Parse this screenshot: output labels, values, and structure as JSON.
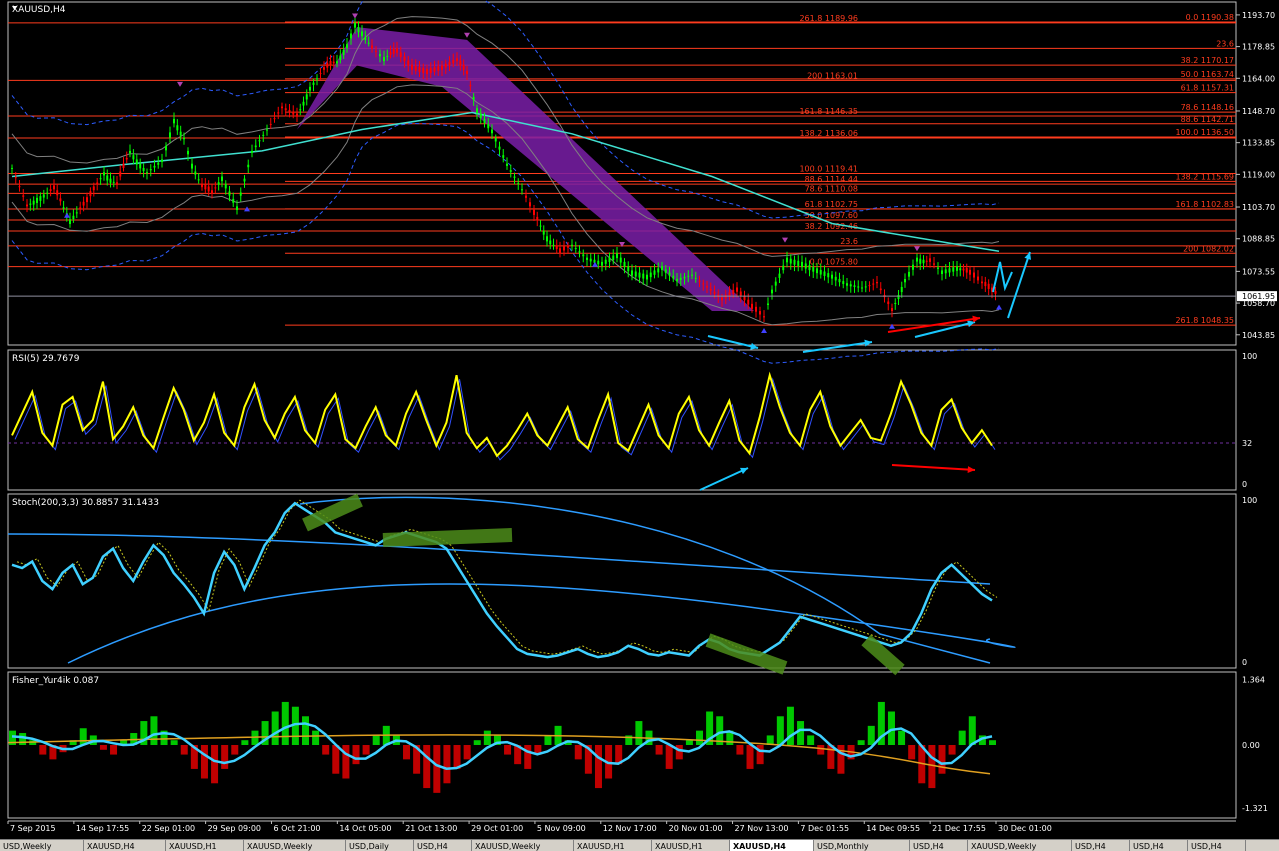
{
  "chart_data": [
    {
      "type": "candlestick",
      "title": "XAUUSD,H4",
      "y_ticks": [
        "1193.70",
        "1178.85",
        "1164.00",
        "1148.70",
        "1133.85",
        "1119.00",
        "1103.70",
        "1088.85",
        "1073.55",
        "1058.70",
        "1043.85"
      ],
      "ylim": [
        1040,
        1196
      ],
      "current_price": "1061.95",
      "fib_left": [
        {
          "label": "261.8 1189.96",
          "value": 1189.96
        },
        {
          "label": "200 1163.01",
          "value": 1163.01
        },
        {
          "label": "161.8 1146.35",
          "value": 1146.35
        },
        {
          "label": "138.2 1136.06",
          "value": 1136.06
        },
        {
          "label": "100.0 1119.41",
          "value": 1119.41
        },
        {
          "label": "88.6 1114.44",
          "value": 1114.44
        },
        {
          "label": "78.6 1110.08",
          "value": 1110.08
        },
        {
          "label": "61.8 1102.75",
          "value": 1102.75
        },
        {
          "label": "50.0 1097.60",
          "value": 1097.6
        },
        {
          "label": "38.2 1092.46",
          "value": 1092.46
        },
        {
          "label": "23.6",
          "value": 1085.5
        },
        {
          "label": "0.0 1075.80",
          "value": 1075.8
        }
      ],
      "fib_right": [
        {
          "label": "0.0 1190.38",
          "value": 1190.38
        },
        {
          "label": "23.6",
          "value": 1178.0
        },
        {
          "label": "38.2 1170.17",
          "value": 1170.17
        },
        {
          "label": "50.0 1163.74",
          "value": 1163.74
        },
        {
          "label": "61.8 1157.31",
          "value": 1157.31
        },
        {
          "label": "78.6 1148.16",
          "value": 1148.16
        },
        {
          "label": "88.6 1142.71",
          "value": 1142.71
        },
        {
          "label": "100.0 1136.50",
          "value": 1136.5
        },
        {
          "label": "138.2 1115.69",
          "value": 1115.69
        },
        {
          "label": "161.8 1102.83",
          "value": 1102.83
        },
        {
          "label": "200 1082.02",
          "value": 1082.02
        },
        {
          "label": "261.8 1048.35",
          "value": 1048.35
        }
      ],
      "close_path": [
        [
          0,
          1122
        ],
        [
          15,
          1104
        ],
        [
          25,
          1108
        ],
        [
          42,
          1112
        ],
        [
          58,
          1098
        ],
        [
          75,
          1106
        ],
        [
          92,
          1120
        ],
        [
          105,
          1114
        ],
        [
          118,
          1130
        ],
        [
          135,
          1120
        ],
        [
          150,
          1126
        ],
        [
          162,
          1145
        ],
        [
          172,
          1136
        ],
        [
          180,
          1124
        ],
        [
          190,
          1113
        ],
        [
          200,
          1110
        ],
        [
          210,
          1118
        ],
        [
          225,
          1104
        ],
        [
          240,
          1130
        ],
        [
          255,
          1140
        ],
        [
          270,
          1150
        ],
        [
          285,
          1146
        ],
        [
          298,
          1160
        ],
        [
          312,
          1168
        ],
        [
          325,
          1172
        ],
        [
          335,
          1180
        ],
        [
          343,
          1190
        ],
        [
          350,
          1186
        ],
        [
          360,
          1178
        ],
        [
          372,
          1174
        ],
        [
          385,
          1176
        ],
        [
          400,
          1168
        ],
        [
          415,
          1166
        ],
        [
          430,
          1168
        ],
        [
          445,
          1172
        ],
        [
          455,
          1166
        ],
        [
          465,
          1150
        ],
        [
          480,
          1140
        ],
        [
          495,
          1124
        ],
        [
          510,
          1112
        ],
        [
          522,
          1100
        ],
        [
          535,
          1090
        ],
        [
          548,
          1082
        ],
        [
          560,
          1086
        ],
        [
          575,
          1080
        ],
        [
          590,
          1078
        ],
        [
          605,
          1082
        ],
        [
          620,
          1074
        ],
        [
          635,
          1072
        ],
        [
          650,
          1076
        ],
        [
          665,
          1070
        ],
        [
          680,
          1072
        ],
        [
          695,
          1066
        ],
        [
          710,
          1060
        ],
        [
          725,
          1064
        ],
        [
          740,
          1056
        ],
        [
          752,
          1052
        ],
        [
          760,
          1065
        ],
        [
          775,
          1080
        ],
        [
          790,
          1078
        ],
        [
          805,
          1075
        ],
        [
          820,
          1072
        ],
        [
          835,
          1068
        ],
        [
          850,
          1066
        ],
        [
          865,
          1068
        ],
        [
          880,
          1055
        ],
        [
          893,
          1070
        ],
        [
          905,
          1080
        ],
        [
          918,
          1078
        ],
        [
          930,
          1074
        ],
        [
          945,
          1076
        ],
        [
          958,
          1072
        ],
        [
          970,
          1068
        ],
        [
          980,
          1064
        ],
        [
          987,
          1062
        ]
      ]
    },
    {
      "type": "line",
      "title": "RSI(5) 29.7679",
      "y_ticks": [
        "100",
        "32",
        "0"
      ],
      "ylim": [
        0,
        100
      ],
      "level": 32,
      "values": [
        38,
        55,
        72,
        40,
        30,
        62,
        68,
        42,
        50,
        80,
        35,
        45,
        60,
        38,
        28,
        52,
        75,
        58,
        34,
        48,
        70,
        40,
        30,
        60,
        78,
        50,
        36,
        55,
        68,
        42,
        32,
        58,
        70,
        35,
        28,
        45,
        60,
        38,
        30,
        55,
        72,
        50,
        30,
        48,
        85,
        40,
        28,
        36,
        22,
        30,
        42,
        55,
        38,
        30,
        45,
        60,
        35,
        28,
        50,
        70,
        32,
        26,
        44,
        62,
        38,
        28,
        55,
        68,
        42,
        30,
        48,
        65,
        34,
        24,
        52,
        85,
        60,
        40,
        30,
        58,
        72,
        45,
        30,
        40,
        50,
        36,
        34,
        55,
        80,
        62,
        40,
        30,
        58,
        66,
        44,
        32,
        42,
        30
      ]
    },
    {
      "type": "line",
      "title": "Stoch(200,3,3) 30.8857 31.1433",
      "y_ticks": [
        "100",
        "0"
      ],
      "ylim": [
        0,
        100
      ],
      "values": [
        60,
        58,
        62,
        50,
        45,
        55,
        60,
        48,
        52,
        65,
        70,
        58,
        50,
        62,
        72,
        66,
        55,
        48,
        40,
        30,
        55,
        68,
        60,
        45,
        58,
        72,
        80,
        92,
        98,
        94,
        90,
        86,
        80,
        78,
        76,
        74,
        72,
        76,
        78,
        80,
        78,
        76,
        74,
        70,
        60,
        50,
        40,
        30,
        22,
        15,
        8,
        5,
        4,
        3,
        4,
        6,
        8,
        5,
        3,
        4,
        6,
        10,
        8,
        5,
        4,
        6,
        5,
        4,
        10,
        14,
        12,
        8,
        6,
        5,
        4,
        8,
        12,
        20,
        28,
        26,
        24,
        22,
        20,
        18,
        16,
        14,
        12,
        10,
        12,
        18,
        30,
        45,
        55,
        60,
        54,
        48,
        42,
        38
      ]
    },
    {
      "type": "bar",
      "title": "Fisher_Yur4ik 0.087",
      "y_ticks": [
        "1.364",
        "0.00",
        "-1.321"
      ],
      "ylim": [
        -1.4,
        1.4
      ],
      "values": [
        0.3,
        0.25,
        0.1,
        -0.2,
        -0.3,
        -0.15,
        0.1,
        0.35,
        0.2,
        -0.1,
        -0.2,
        0.1,
        0.25,
        0.5,
        0.6,
        0.3,
        0.1,
        -0.2,
        -0.5,
        -0.7,
        -0.8,
        -0.5,
        -0.2,
        0.1,
        0.3,
        0.5,
        0.7,
        0.9,
        0.8,
        0.6,
        0.3,
        -0.2,
        -0.6,
        -0.7,
        -0.4,
        -0.2,
        0.2,
        0.4,
        0.2,
        -0.3,
        -0.6,
        -0.9,
        -1.0,
        -0.8,
        -0.5,
        -0.3,
        0.1,
        0.3,
        0.2,
        -0.2,
        -0.4,
        -0.5,
        -0.2,
        0.2,
        0.4,
        0.1,
        -0.3,
        -0.6,
        -0.9,
        -0.7,
        -0.4,
        0.2,
        0.5,
        0.3,
        -0.2,
        -0.5,
        -0.3,
        0.1,
        0.3,
        0.7,
        0.6,
        0.3,
        -0.2,
        -0.5,
        -0.4,
        0.2,
        0.6,
        0.8,
        0.5,
        0.2,
        -0.2,
        -0.5,
        -0.6,
        -0.3,
        0.1,
        0.4,
        0.9,
        0.7,
        0.3,
        -0.3,
        -0.8,
        -0.9,
        -0.6,
        -0.2,
        0.3,
        0.6,
        0.2,
        0.1
      ]
    }
  ],
  "x_ticks": [
    "7 Sep 2015",
    "14 Sep 17:55",
    "22 Sep 01:00",
    "29 Sep 09:00",
    "6 Oct 21:00",
    "14 Oct 05:00",
    "21 Oct 13:00",
    "29 Oct 01:00",
    "5 Nov 09:00",
    "12 Nov 17:00",
    "20 Nov 01:00",
    "27 Nov 13:00",
    "7 Dec 01:55",
    "14 Dec 09:55",
    "21 Dec 17:55",
    "30 Dec 01:00"
  ],
  "tabs": [
    "USD,Weekly",
    "XAUUSD,H4",
    "XAUUSD,H1",
    "XAUUSD,Weekly",
    "USD,Daily",
    "USD,H4",
    "XAUUSD,Weekly",
    "XAUUSD,H1",
    "XAUUSD,H1",
    "XAUUSD,H4",
    "USD,Monthly",
    "USD,H4",
    "XAUUSD,Weekly",
    "USD,H4",
    "USD,H4",
    "USD,H4"
  ],
  "colors": {
    "grid": "#c0c0c0",
    "fib": "#ff3c1e",
    "rsi": "#ffff00",
    "stoch": "#2d9cff",
    "fisher_up": "#00c800",
    "fisher_down": "#c00000",
    "trend_fill": "#7a1fa8",
    "annotation_cyan": "#19c8ff",
    "annotation_red": "#ff0000",
    "highlight_green": "#4d8c1a"
  }
}
